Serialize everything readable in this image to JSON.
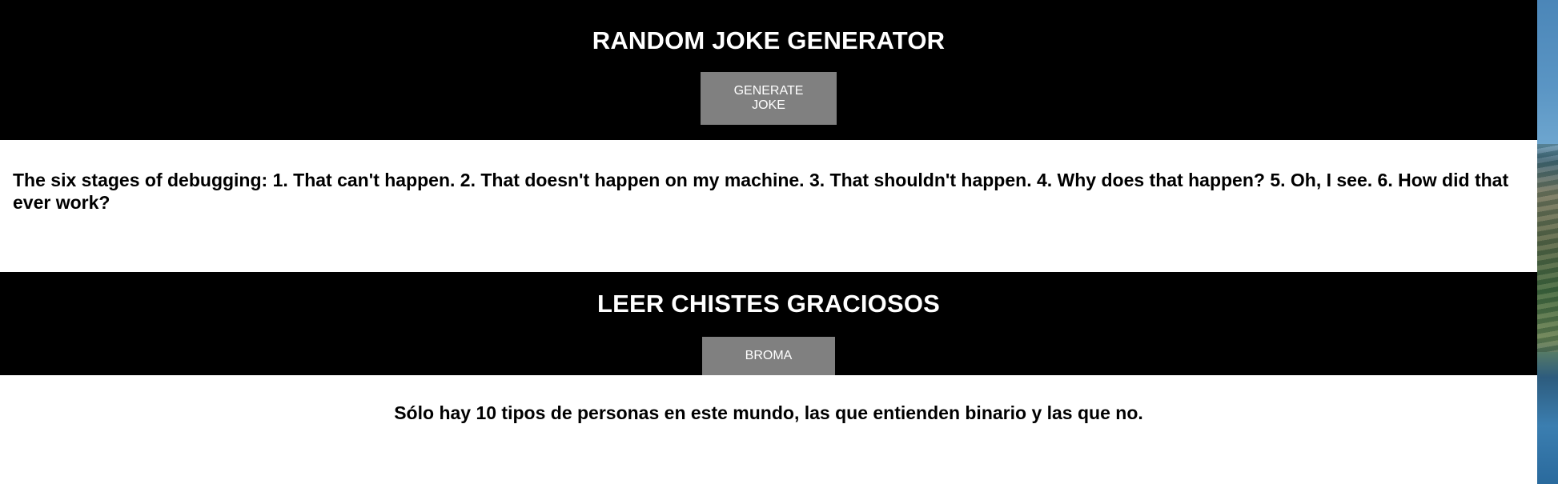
{
  "section1": {
    "title": "RANDOM JOKE GENERATOR",
    "button_label": "GENERATE JOKE",
    "joke_text": "The six stages of debugging: 1. That can't happen. 2. That doesn't happen on my machine. 3. That shouldn't happen. 4. Why does that happen? 5. Oh, I see. 6. How did that ever work?"
  },
  "section2": {
    "title": "LEER CHISTES GRACIOSOS",
    "button_label": "BROMA",
    "joke_text": "Sólo hay 10 tipos de personas en este mundo, las que entienden binario y las que no."
  },
  "colors": {
    "header_bg": "#000000",
    "button_bg": "#808080",
    "text_light": "#ffffff",
    "text_dark": "#000000"
  }
}
